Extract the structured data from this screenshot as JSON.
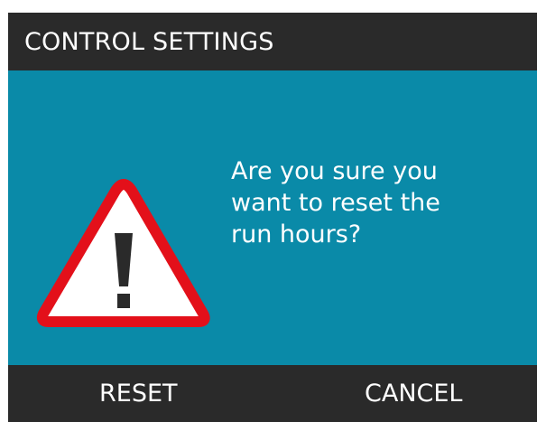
{
  "screen": {
    "title": "CONTROL SETTINGS"
  },
  "dialog": {
    "icon": "warning-icon",
    "message": "Are you sure you\nwant to reset the\nrun hours?"
  },
  "actions": {
    "reset_label": "RESET",
    "cancel_label": "CANCEL"
  },
  "colors": {
    "header_bg": "#2a2a2a",
    "body_bg": "#0a8aa8",
    "warning_red": "#e3101a",
    "warning_fill": "#ffffff",
    "text": "#ffffff"
  }
}
